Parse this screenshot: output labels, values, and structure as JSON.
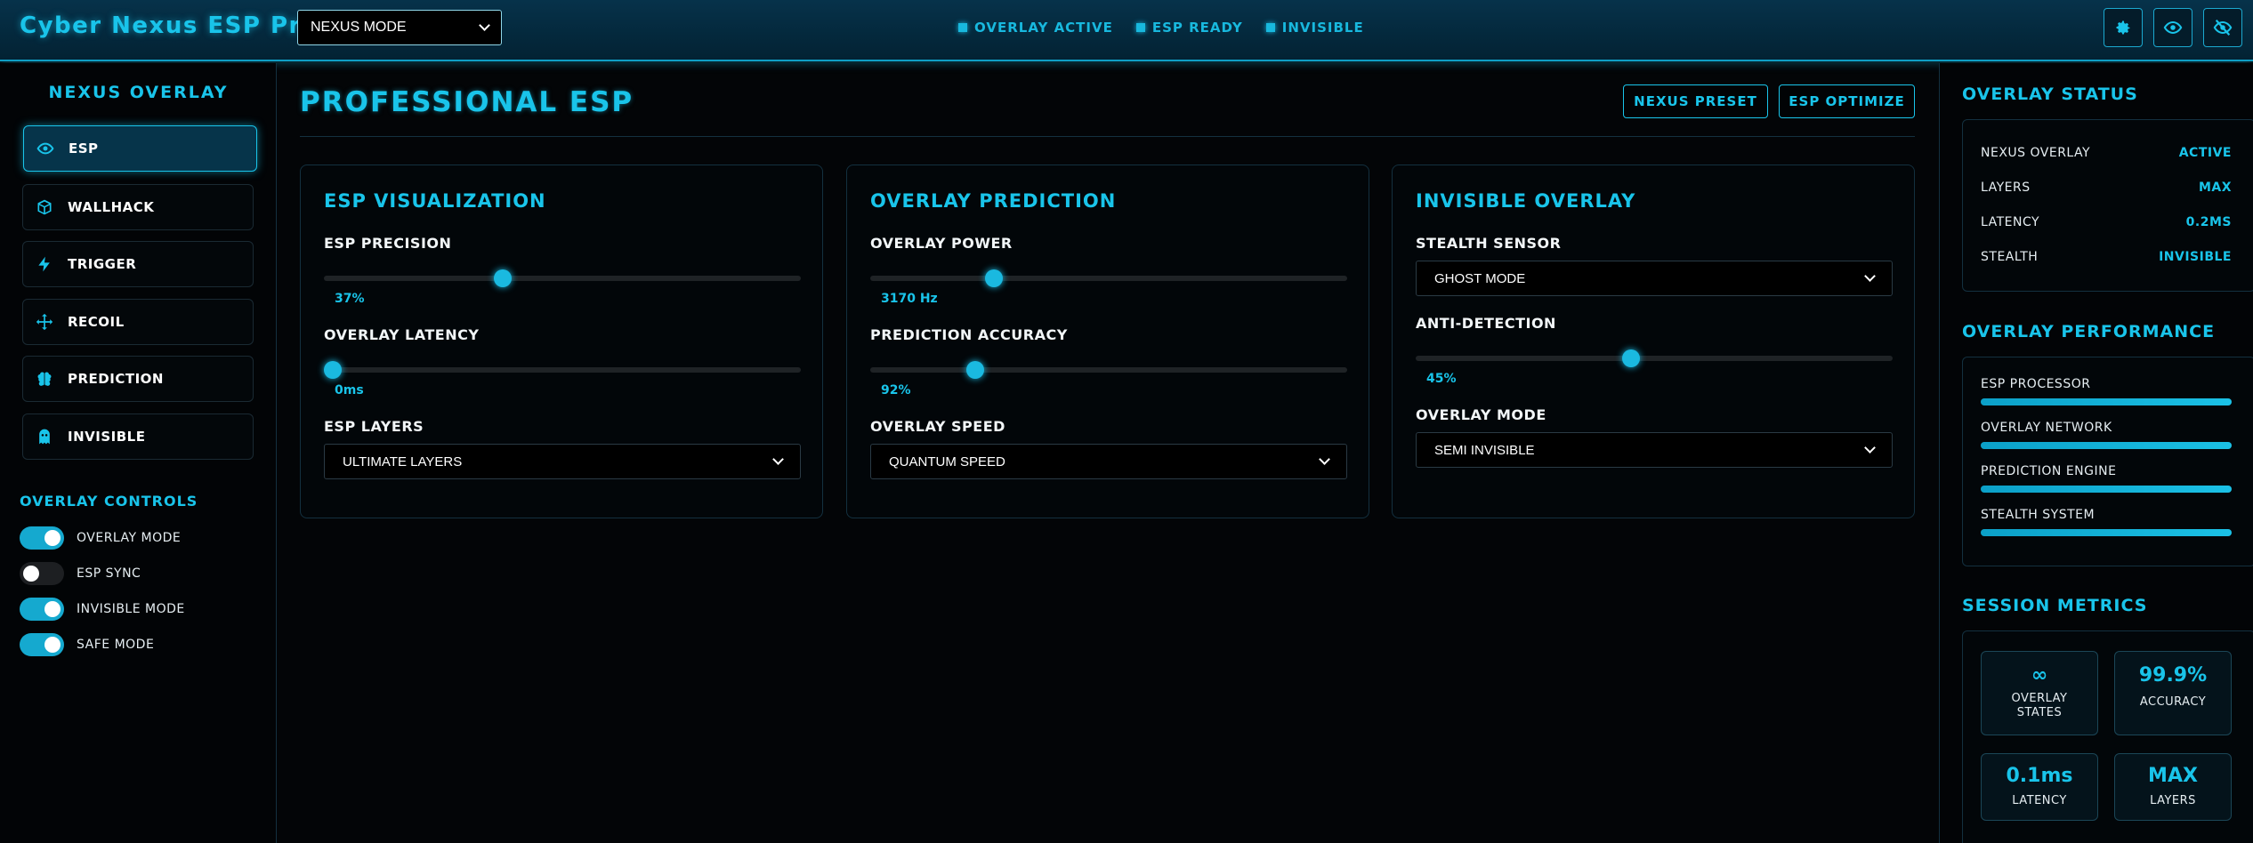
{
  "app": {
    "title": "Cyber Nexus ESP Pro",
    "mode_select": "NEXUS MODE",
    "status": [
      "OVERLAY ACTIVE",
      "ESP READY",
      "INVISIBLE"
    ],
    "icons": [
      "gear-icon",
      "eye-icon",
      "eye-off-icon"
    ]
  },
  "sidebar": {
    "title": "NEXUS OVERLAY",
    "items": [
      {
        "label": "ESP",
        "icon": "eye-icon",
        "active": true
      },
      {
        "label": "WALLHACK",
        "icon": "cube-icon",
        "active": false
      },
      {
        "label": "TRIGGER",
        "icon": "bolt-icon",
        "active": false
      },
      {
        "label": "RECOIL",
        "icon": "crosshair-move-icon",
        "active": false
      },
      {
        "label": "PREDICTION",
        "icon": "brain-icon",
        "active": false
      },
      {
        "label": "INVISIBLE",
        "icon": "ghost-icon",
        "active": false
      }
    ],
    "controls_title": "OVERLAY CONTROLS",
    "toggles": [
      {
        "label": "OVERLAY MODE",
        "on": true
      },
      {
        "label": "ESP SYNC",
        "on": false
      },
      {
        "label": "INVISIBLE MODE",
        "on": true
      },
      {
        "label": "SAFE MODE",
        "on": true
      }
    ]
  },
  "main": {
    "title": "PROFESSIONAL ESP",
    "buttons": {
      "preset": "NEXUS PRESET",
      "optimize": "ESP OPTIMIZE"
    },
    "panels": [
      {
        "title": "ESP VISUALIZATION",
        "slider1": {
          "label": "ESP PRECISION",
          "value": "37%",
          "fraction": 0.37
        },
        "slider2": {
          "label": "OVERLAY LATENCY",
          "value": "0ms",
          "fraction": 0.0
        },
        "select": {
          "label": "ESP LAYERS",
          "value": "ULTIMATE LAYERS"
        }
      },
      {
        "title": "OVERLAY PREDICTION",
        "slider1": {
          "label": "OVERLAY POWER",
          "value": "3170 Hz",
          "fraction": 0.25
        },
        "slider2": {
          "label": "PREDICTION ACCURACY",
          "value": "92%",
          "fraction": 0.21
        },
        "select": {
          "label": "OVERLAY SPEED",
          "value": "QUANTUM SPEED"
        }
      },
      {
        "title": "INVISIBLE OVERLAY",
        "select1": {
          "label": "STEALTH SENSOR",
          "value": "GHOST MODE"
        },
        "slider": {
          "label": "ANTI-DETECTION",
          "value": "45%",
          "fraction": 0.45
        },
        "select2": {
          "label": "OVERLAY MODE",
          "value": "SEMI INVISIBLE"
        }
      }
    ]
  },
  "right": {
    "status_title": "OVERLAY STATUS",
    "status": [
      {
        "k": "NEXUS OVERLAY",
        "v": "ACTIVE"
      },
      {
        "k": "LAYERS",
        "v": "MAX"
      },
      {
        "k": "LATENCY",
        "v": "0.2MS"
      },
      {
        "k": "STEALTH",
        "v": "INVISIBLE"
      }
    ],
    "perf_title": "OVERLAY PERFORMANCE",
    "perf": [
      {
        "label": "ESP PROCESSOR",
        "fraction": 1.0
      },
      {
        "label": "OVERLAY NETWORK",
        "fraction": 1.0
      },
      {
        "label": "PREDICTION ENGINE",
        "fraction": 1.0
      },
      {
        "label": "STEALTH SYSTEM",
        "fraction": 1.0
      }
    ],
    "metrics_title": "SESSION METRICS",
    "metrics": [
      {
        "value": "∞",
        "label": "OVERLAY STATES"
      },
      {
        "value": "99.9%",
        "label": "ACCURACY"
      },
      {
        "value": "0.1ms",
        "label": "LATENCY"
      },
      {
        "value": "MAX",
        "label": "LAYERS"
      }
    ]
  },
  "colors": {
    "accent": "#19c4ea",
    "background": "#030507",
    "topbar": "#04293c"
  }
}
